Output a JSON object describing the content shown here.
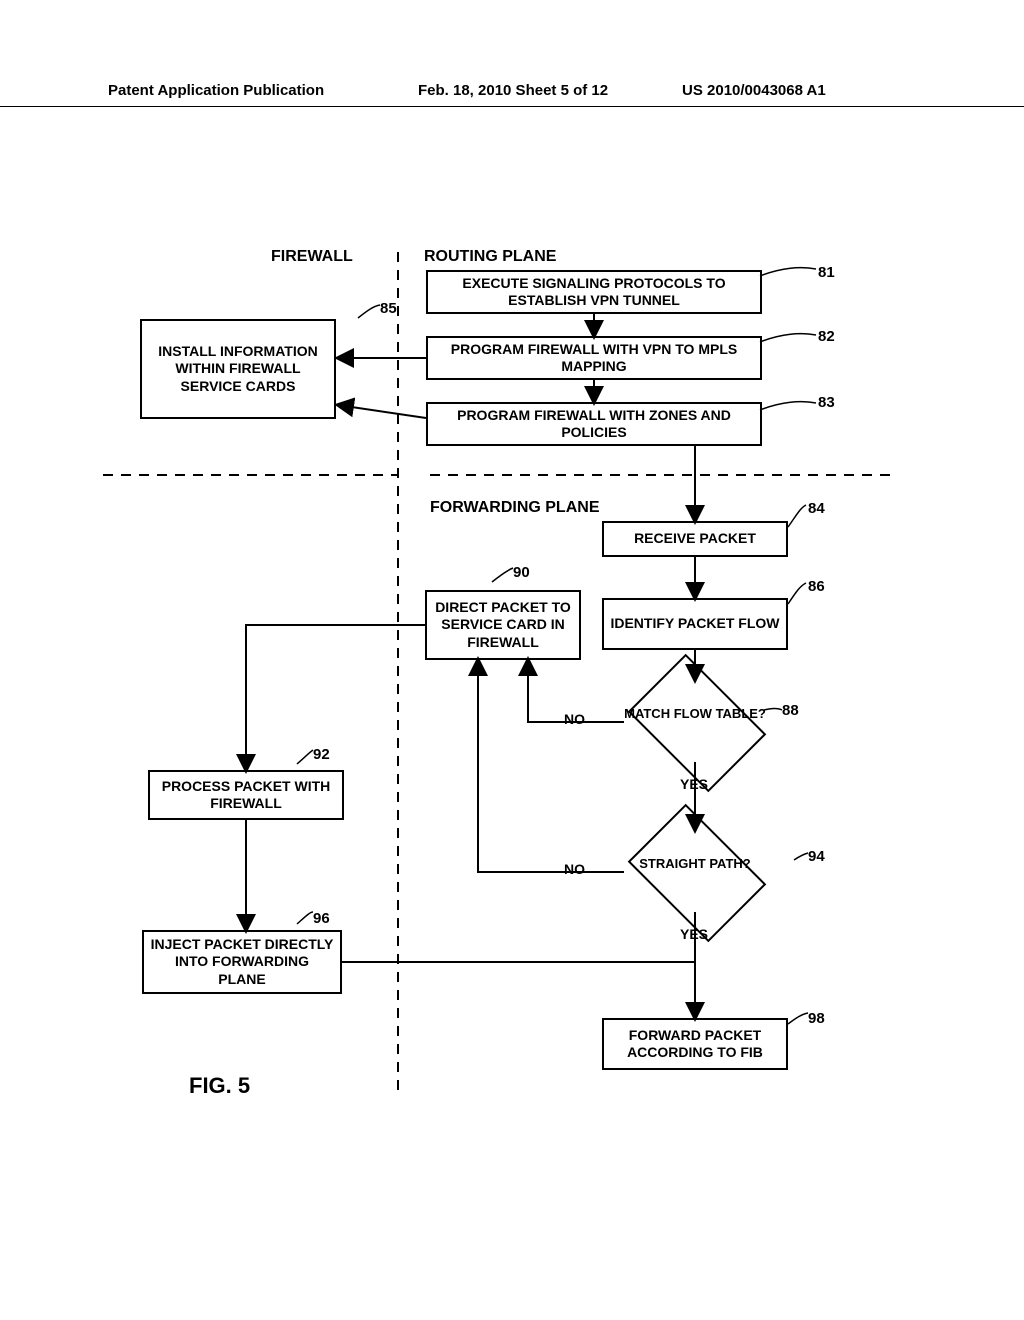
{
  "header": {
    "left": "Patent Application Publication",
    "mid": "Feb. 18, 2010  Sheet 5 of 12",
    "right": "US 2010/0043068 A1"
  },
  "columns": {
    "firewall": "FIREWALL",
    "routing": "ROUTING PLANE",
    "forwarding": "FORWARDING PLANE"
  },
  "boxes": {
    "b81": "EXECUTE SIGNALING PROTOCOLS TO ESTABLISH VPN TUNNEL",
    "b82": "PROGRAM FIREWALL WITH VPN TO MPLS MAPPING",
    "b83": "PROGRAM FIREWALL WITH ZONES AND POLICIES",
    "b84": "RECEIVE PACKET",
    "b85": "INSTALL INFORMATION WITHIN FIREWALL SERVICE CARDS",
    "b86": "IDENTIFY PACKET FLOW",
    "b90": "DIRECT PACKET TO SERVICE CARD IN FIREWALL",
    "b92": "PROCESS PACKET WITH FIREWALL",
    "b96": "INJECT PACKET DIRECTLY INTO FORWARDING PLANE",
    "b98": "FORWARD PACKET ACCORDING TO FIB"
  },
  "diamonds": {
    "d88": "MATCH FLOW TABLE?",
    "d94": "STRAIGHT PATH?"
  },
  "labels": {
    "yes": "YES",
    "no": "NO"
  },
  "refs": {
    "r81": "81",
    "r82": "82",
    "r83": "83",
    "r84": "84",
    "r85": "85",
    "r86": "86",
    "r88": "88",
    "r90": "90",
    "r92": "92",
    "r94": "94",
    "r96": "96",
    "r98": "98"
  },
  "figure": "FIG. 5"
}
